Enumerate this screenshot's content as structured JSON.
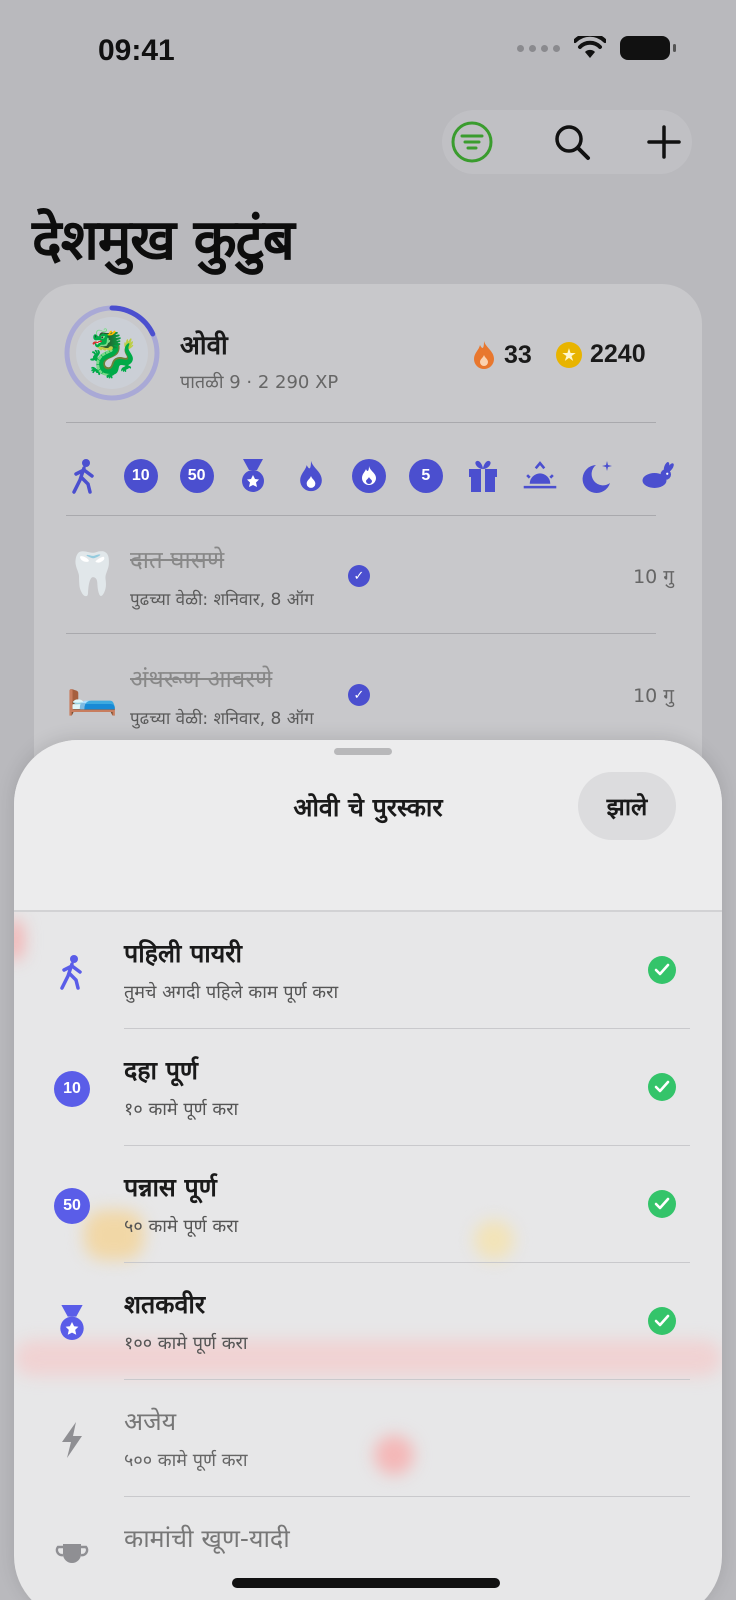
{
  "status_bar": {
    "time": "09:41"
  },
  "toolbar": {
    "filter_icon": "filter-icon",
    "search_icon": "search-icon",
    "add_icon": "plus-icon",
    "accent": "#3a9c2e"
  },
  "page": {
    "title": "देशमुख कुटुंब"
  },
  "member": {
    "name": "ओवी",
    "level_xp": "पातळी 9 · 2 290 XP",
    "avatar": "🐉",
    "level_progress": 0.18,
    "streak": "33",
    "coins": "2240"
  },
  "badges": [
    {
      "icon": "walking-person-icon"
    },
    {
      "icon": "number-badge-icon",
      "label": "10"
    },
    {
      "icon": "number-badge-icon",
      "label": "50"
    },
    {
      "icon": "medal-icon"
    },
    {
      "icon": "flame-icon"
    },
    {
      "icon": "flame-circle-icon"
    },
    {
      "icon": "number-badge-icon",
      "label": "5"
    },
    {
      "icon": "gift-icon"
    },
    {
      "icon": "sunrise-icon"
    },
    {
      "icon": "moon-stars-icon"
    },
    {
      "icon": "hare-icon"
    }
  ],
  "tasks": [
    {
      "emoji": "🦷",
      "title": "दात घासणे",
      "next": "पुढच्या वेळी: शनिवार, 8 ऑग",
      "points": "10 गु"
    },
    {
      "emoji": "🛏️",
      "title": "अंथरूण आवरणे",
      "next": "पुढच्या वेळी: शनिवार, 8 ऑग",
      "points": "10 गु"
    }
  ],
  "sheet": {
    "title": "ओवी चे पुरस्कार",
    "done_label": "झाले",
    "achievements": [
      {
        "icon": "walking-person-icon",
        "title": "पहिली पायरी",
        "desc": "तुमचे अगदी पहिले काम पूर्ण करा",
        "done": true
      },
      {
        "icon": "number-badge-icon",
        "badge": "10",
        "title": "दहा पूर्ण",
        "desc": "१० कामे पूर्ण करा",
        "done": true
      },
      {
        "icon": "number-badge-icon",
        "badge": "50",
        "title": "पन्नास पूर्ण",
        "desc": "५० कामे पूर्ण करा",
        "done": true
      },
      {
        "icon": "medal-icon",
        "title": "शतकवीर",
        "desc": "१०० कामे पूर्ण करा",
        "done": true
      },
      {
        "icon": "bolt-icon",
        "title": "अजेय",
        "desc": "५०० कामे पूर्ण करा",
        "done": false
      },
      {
        "icon": "trophy-icon",
        "title": "कामांची खूण-यादी",
        "desc": "",
        "done": false
      }
    ]
  },
  "colors": {
    "badge_blue": "#4b4fcf",
    "check_green": "#34c46a",
    "streak_orange": "#e8772e",
    "coin_gold": "#e8b400"
  }
}
